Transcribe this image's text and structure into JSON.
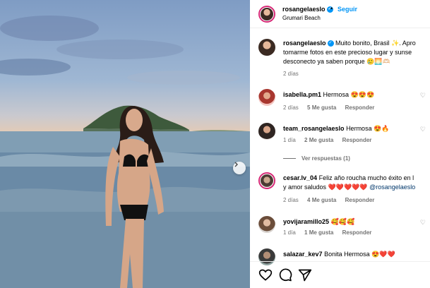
{
  "post": {
    "username": "rosangelaeslo",
    "location": "Grumari Beach",
    "follow_separator": "•",
    "follow_label": "Seguir"
  },
  "caption": {
    "username": "rosangelaeslo",
    "line1": "Muito bonito, Brasil ✨. Apro",
    "line2": "tomarme fotos en este precioso lugar y sunse",
    "line3": "desconecto ya saben porque 🥲🌅🫶🏻",
    "time": "2 días"
  },
  "comments": [
    {
      "username": "isabella.pm1",
      "text": "Hermosa 😍😍😍",
      "time": "2 días",
      "likes": "5 Me gusta",
      "reply": "Responder"
    },
    {
      "username": "team_rosangelaeslo",
      "text": "Hermosa 😍🔥",
      "time": "1 día",
      "likes": "2 Me gusta",
      "reply": "Responder"
    },
    {
      "username": "cesar.lv_04",
      "text": "Feliz año roucha mucho éxito en l",
      "text2": "y amor saludos ❤️❤️❤️❤️❤️",
      "mention": "@rosangelaeslo",
      "time": "2 días",
      "likes": "4 Me gusta",
      "reply": "Responder"
    },
    {
      "username": "yovijaramillo25",
      "text": "🥰🥰🥰",
      "time": "1 día",
      "likes": "1 Me gusta",
      "reply": "Responder"
    },
    {
      "username": "salazar_kev7",
      "text": "Bonita Hermosa 😍❤️❤️"
    }
  ],
  "view_replies": "Ver respuestas (1)",
  "icons": {
    "verified": "verified-badge-icon",
    "like": "heart-icon",
    "comment": "comment-icon",
    "share": "share-icon",
    "next": "chevron-right-icon"
  },
  "colors": {
    "accent": "#0095f6",
    "muted": "#737373",
    "mention": "#00376b"
  }
}
